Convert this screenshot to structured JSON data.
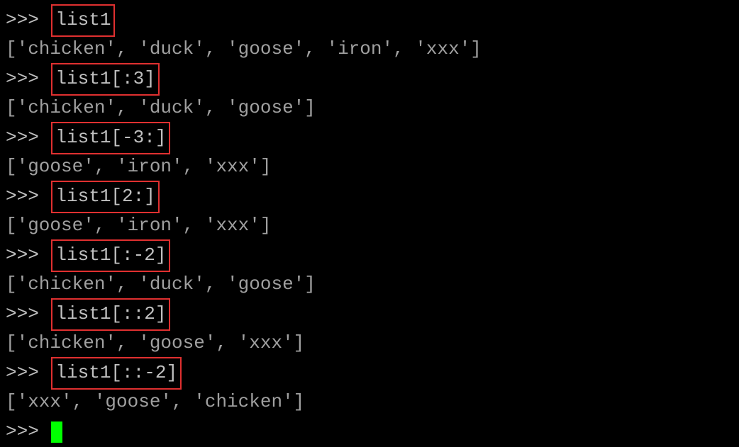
{
  "prompt": ">>> ",
  "entries": [
    {
      "input": "list1",
      "output": "['chicken', 'duck', 'goose', 'iron', 'xxx']"
    },
    {
      "input": "list1[:3]",
      "output": "['chicken', 'duck', 'goose']"
    },
    {
      "input": "list1[-3:]",
      "output": "['goose', 'iron', 'xxx']"
    },
    {
      "input": "list1[2:]",
      "output": "['goose', 'iron', 'xxx']"
    },
    {
      "input": "list1[:-2]",
      "output": "['chicken', 'duck', 'goose']"
    },
    {
      "input": "list1[::2]",
      "output": "['chicken', 'goose', 'xxx']"
    },
    {
      "input": "list1[::-2]",
      "output": "['xxx', 'goose', 'chicken']"
    }
  ]
}
